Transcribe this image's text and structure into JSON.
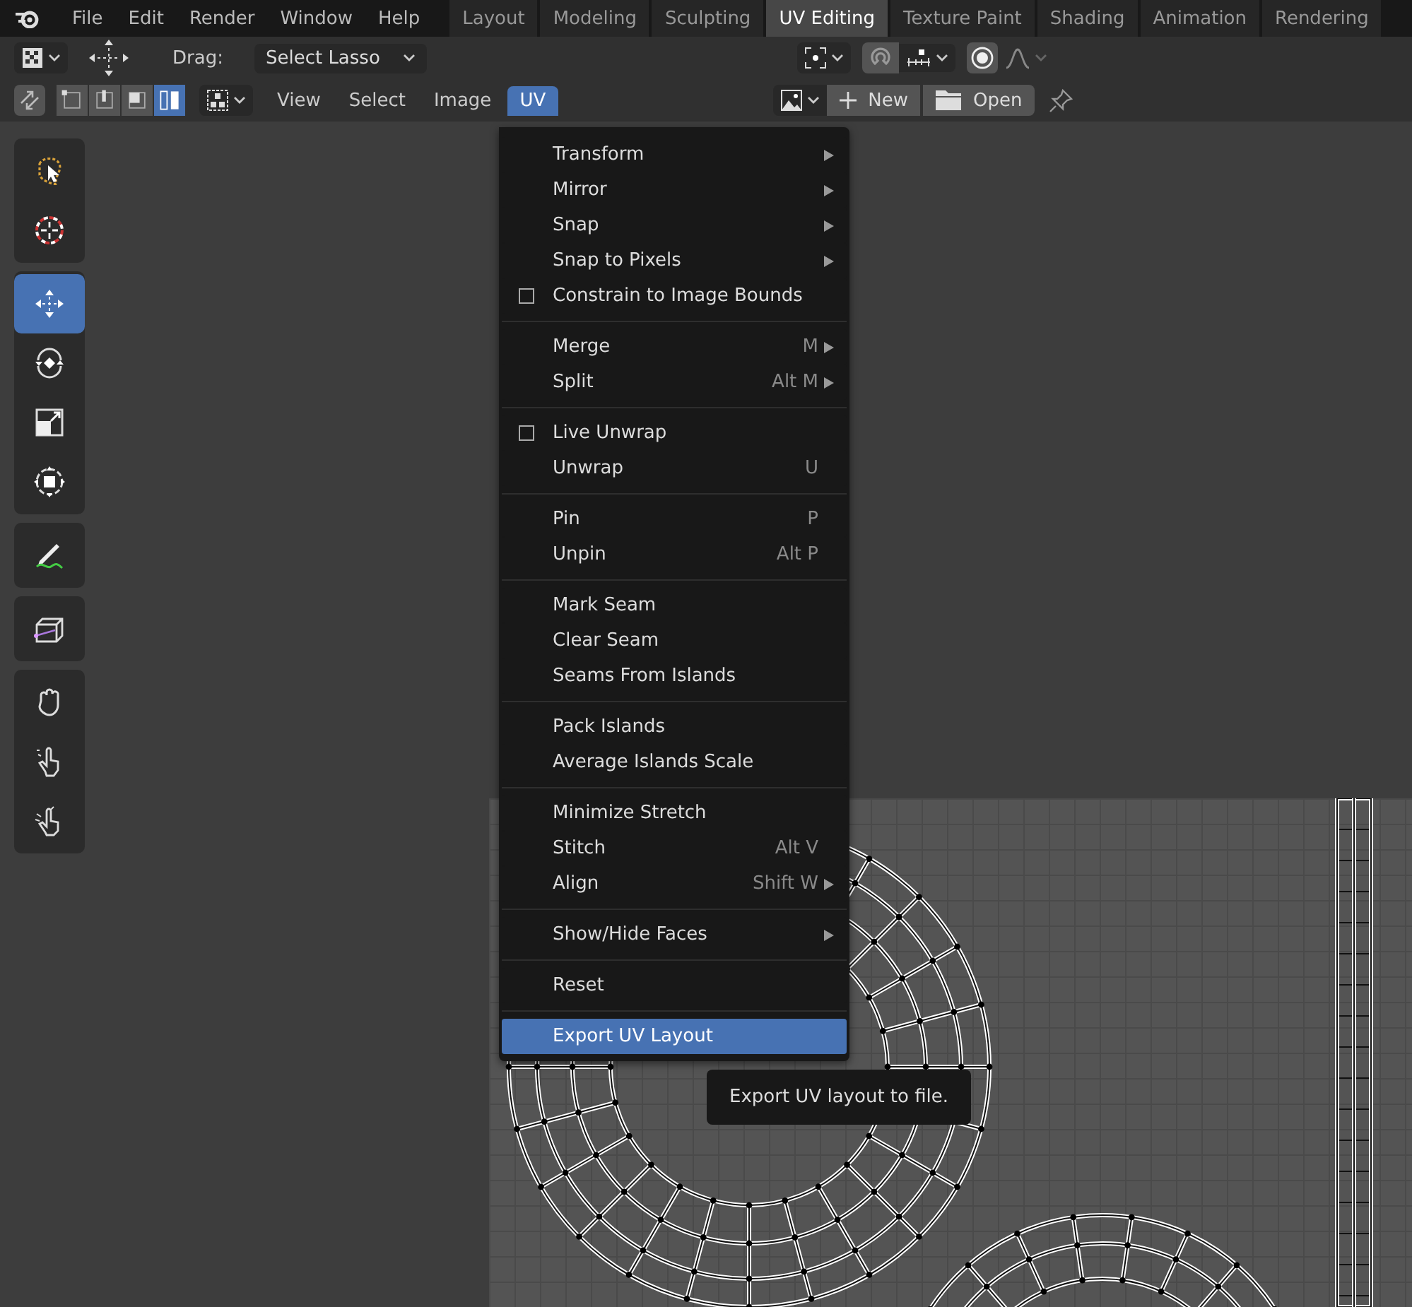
{
  "top_bar": {
    "menus": [
      "File",
      "Edit",
      "Render",
      "Window",
      "Help"
    ],
    "workspace_tabs": [
      {
        "label": "Layout",
        "selected": false
      },
      {
        "label": "Modeling",
        "selected": false
      },
      {
        "label": "Sculpting",
        "selected": false
      },
      {
        "label": "UV Editing",
        "selected": true
      },
      {
        "label": "Texture Paint",
        "selected": false
      },
      {
        "label": "Shading",
        "selected": false
      },
      {
        "label": "Animation",
        "selected": false
      },
      {
        "label": "Rendering",
        "selected": false
      }
    ]
  },
  "tool_header": {
    "drag_label": "Drag:",
    "drag_value": "Select Lasso"
  },
  "editor_header": {
    "select_modes": [
      {
        "kind": "vertex",
        "selected": false
      },
      {
        "kind": "edge",
        "selected": false
      },
      {
        "kind": "face",
        "selected": false
      },
      {
        "kind": "island",
        "selected": true
      }
    ],
    "menus": [
      {
        "label": "View",
        "selected": false
      },
      {
        "label": "Select",
        "selected": false
      },
      {
        "label": "Image",
        "selected": false
      },
      {
        "label": "UV",
        "selected": true
      }
    ],
    "new_button": "New",
    "open_button": "Open"
  },
  "toolbar": [
    [
      {
        "kind": "lasso",
        "selected": false
      },
      {
        "kind": "cursor",
        "selected": false
      }
    ],
    [
      {
        "kind": "move",
        "selected": true
      },
      {
        "kind": "rotate",
        "selected": false
      },
      {
        "kind": "scale",
        "selected": false
      },
      {
        "kind": "transform",
        "selected": false
      }
    ],
    [
      {
        "kind": "annotate",
        "selected": false
      }
    ],
    [
      {
        "kind": "cube",
        "selected": false
      }
    ],
    [
      {
        "kind": "grab",
        "selected": false
      },
      {
        "kind": "relax",
        "selected": false
      },
      {
        "kind": "pinch",
        "selected": false
      }
    ]
  ],
  "uv_menu": [
    [
      {
        "kind": "submenu",
        "label": "Transform",
        "selected": false
      },
      {
        "kind": "submenu",
        "label": "Mirror",
        "selected": false
      },
      {
        "kind": "submenu",
        "label": "Snap",
        "selected": false
      },
      {
        "kind": "submenu",
        "label": "Snap to Pixels",
        "selected": false
      },
      {
        "kind": "checkbox",
        "label": "Constrain to Image Bounds",
        "checked": false,
        "selected": false
      }
    ],
    [
      {
        "kind": "submenu",
        "label": "Merge",
        "shortcut": "M",
        "selected": false
      },
      {
        "kind": "submenu",
        "label": "Split",
        "shortcut": "Alt M",
        "selected": false
      }
    ],
    [
      {
        "kind": "checkbox",
        "label": "Live Unwrap",
        "checked": false,
        "selected": false
      },
      {
        "kind": "item",
        "label": "Unwrap",
        "shortcut": "U",
        "selected": false
      }
    ],
    [
      {
        "kind": "item",
        "label": "Pin",
        "shortcut": "P",
        "selected": false
      },
      {
        "kind": "item",
        "label": "Unpin",
        "shortcut": "Alt P",
        "selected": false
      }
    ],
    [
      {
        "kind": "item",
        "label": "Mark Seam",
        "selected": false
      },
      {
        "kind": "item",
        "label": "Clear Seam",
        "selected": false
      },
      {
        "kind": "item",
        "label": "Seams From Islands",
        "selected": false
      }
    ],
    [
      {
        "kind": "item",
        "label": "Pack Islands",
        "selected": false
      },
      {
        "kind": "item",
        "label": "Average Islands Scale",
        "selected": false
      }
    ],
    [
      {
        "kind": "item",
        "label": "Minimize Stretch",
        "selected": false
      },
      {
        "kind": "item",
        "label": "Stitch",
        "shortcut": "Alt V",
        "selected": false
      },
      {
        "kind": "submenu",
        "label": "Align",
        "shortcut": "Shift W",
        "selected": false
      }
    ],
    [
      {
        "kind": "submenu",
        "label": "Show/Hide Faces",
        "selected": false
      }
    ],
    [
      {
        "kind": "item",
        "label": "Reset",
        "selected": false
      }
    ],
    [
      {
        "kind": "item",
        "label": "Export UV Layout",
        "selected": true
      }
    ]
  ],
  "tooltip": "Export UV layout to file."
}
